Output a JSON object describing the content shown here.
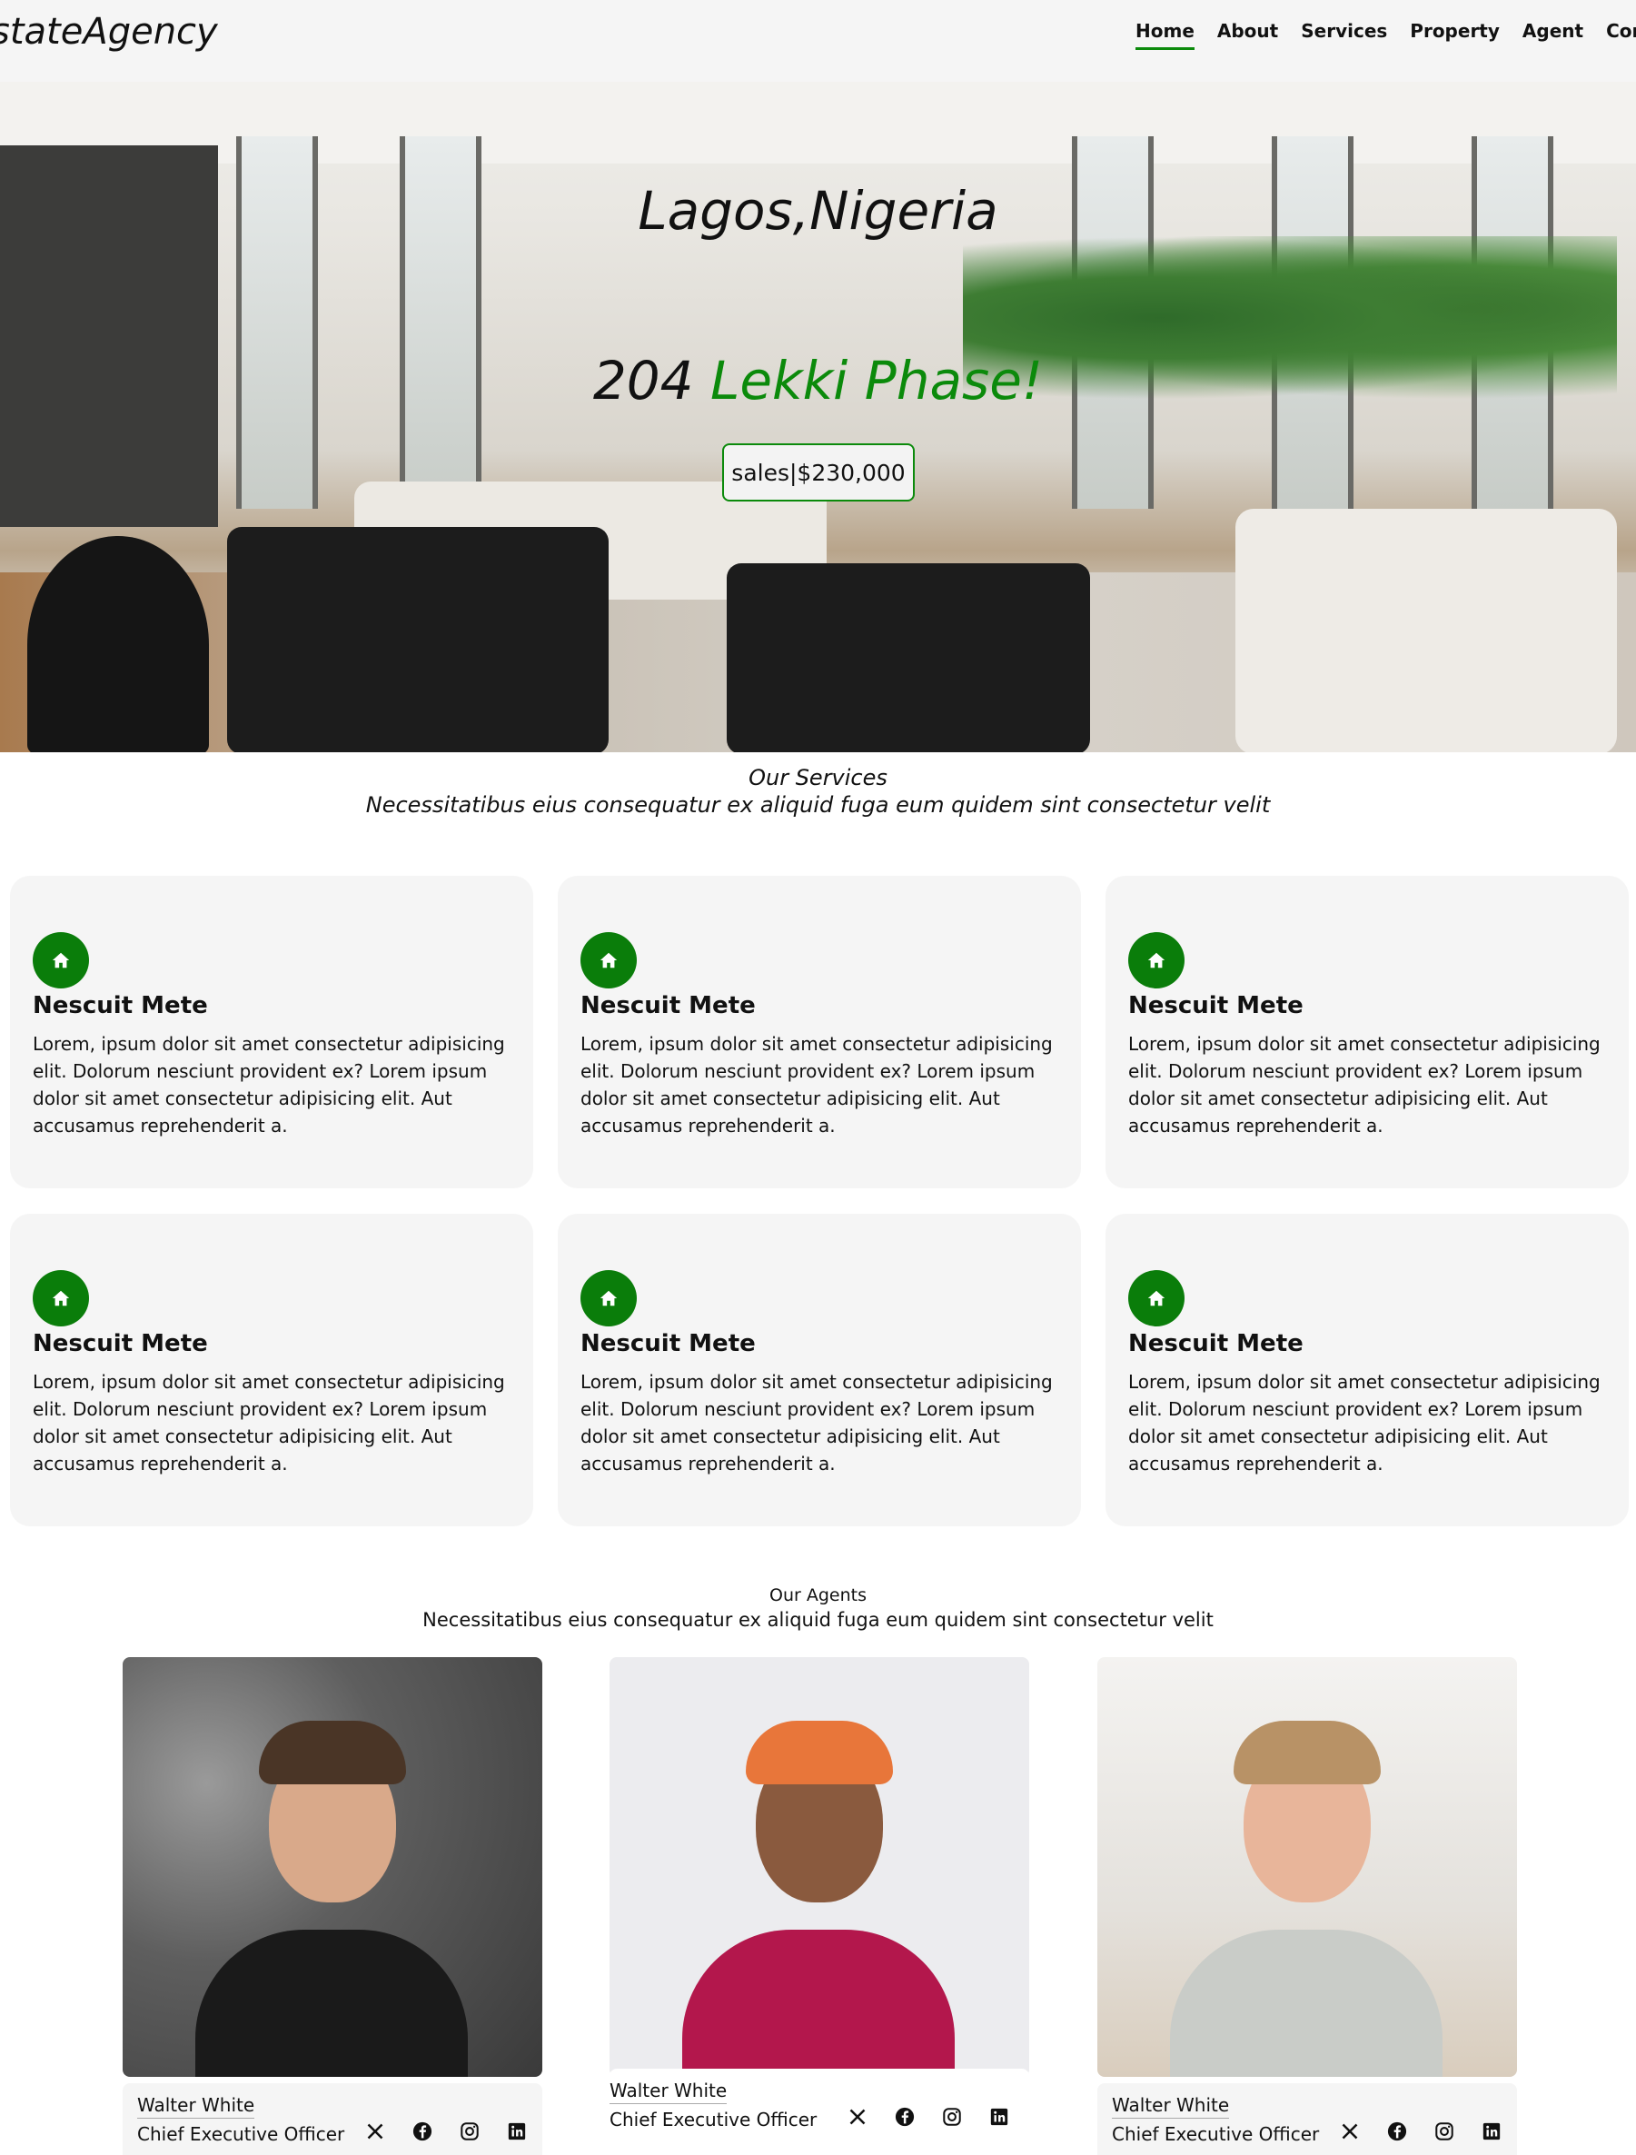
{
  "nav": {
    "logo": "stateAgency",
    "links": [
      "Home",
      "About",
      "Services",
      "Property",
      "Agent",
      "Conta"
    ]
  },
  "hero": {
    "city": "Lagos,Nigeria",
    "address_number": "204",
    "address_street": "Lekki Phase!",
    "price_label": "sales|$230,000"
  },
  "services": {
    "title": "Our Services",
    "subtitle": "Necessitatibus eius consequatur ex aliquid fuga eum quidem sint consectetur velit",
    "cards": [
      {
        "icon": "house-icon",
        "title": "Nescuit Mete",
        "text": "Lorem, ipsum dolor sit amet consectetur adipisicing elit. Dolorum nesciunt provident ex? Lorem ipsum dolor sit amet consectetur adipisicing elit. Aut accusamus reprehenderit a."
      },
      {
        "icon": "house-icon",
        "title": "Nescuit Mete",
        "text": "Lorem, ipsum dolor sit amet consectetur adipisicing elit. Dolorum nesciunt provident ex? Lorem ipsum dolor sit amet consectetur adipisicing elit. Aut accusamus reprehenderit a."
      },
      {
        "icon": "house-icon",
        "title": "Nescuit Mete",
        "text": "Lorem, ipsum dolor sit amet consectetur adipisicing elit. Dolorum nesciunt provident ex? Lorem ipsum dolor sit amet consectetur adipisicing elit. Aut accusamus reprehenderit a."
      },
      {
        "icon": "house-icon",
        "title": "Nescuit Mete",
        "text": "Lorem, ipsum dolor sit amet consectetur adipisicing elit. Dolorum nesciunt provident ex? Lorem ipsum dolor sit amet consectetur adipisicing elit. Aut accusamus reprehenderit a."
      },
      {
        "icon": "house-icon",
        "title": "Nescuit Mete",
        "text": "Lorem, ipsum dolor sit amet consectetur adipisicing elit. Dolorum nesciunt provident ex? Lorem ipsum dolor sit amet consectetur adipisicing elit. Aut accusamus reprehenderit a."
      },
      {
        "icon": "house-icon",
        "title": "Nescuit Mete",
        "text": "Lorem, ipsum dolor sit amet consectetur adipisicing elit. Dolorum nesciunt provident ex? Lorem ipsum dolor sit amet consectetur adipisicing elit. Aut accusamus reprehenderit a."
      }
    ]
  },
  "agents": {
    "title": "Our Agents",
    "subtitle": "Necessitatibus eius consequatur ex aliquid fuga eum quidem sint consectetur velit",
    "list": [
      {
        "name": "Walter White",
        "role": "Chief Executive Officer"
      },
      {
        "name": "Walter White",
        "role": "Chief Executive Officer"
      },
      {
        "name": "Walter White",
        "role": "Chief Executive Officer"
      }
    ],
    "social_icons": [
      "x-icon",
      "facebook-icon",
      "instagram-icon",
      "linkedin-icon"
    ]
  },
  "colors": {
    "accent_green": "#0b8a0b",
    "card_bg": "#f5f5f5",
    "nav_bg": "#f5f5f5"
  }
}
